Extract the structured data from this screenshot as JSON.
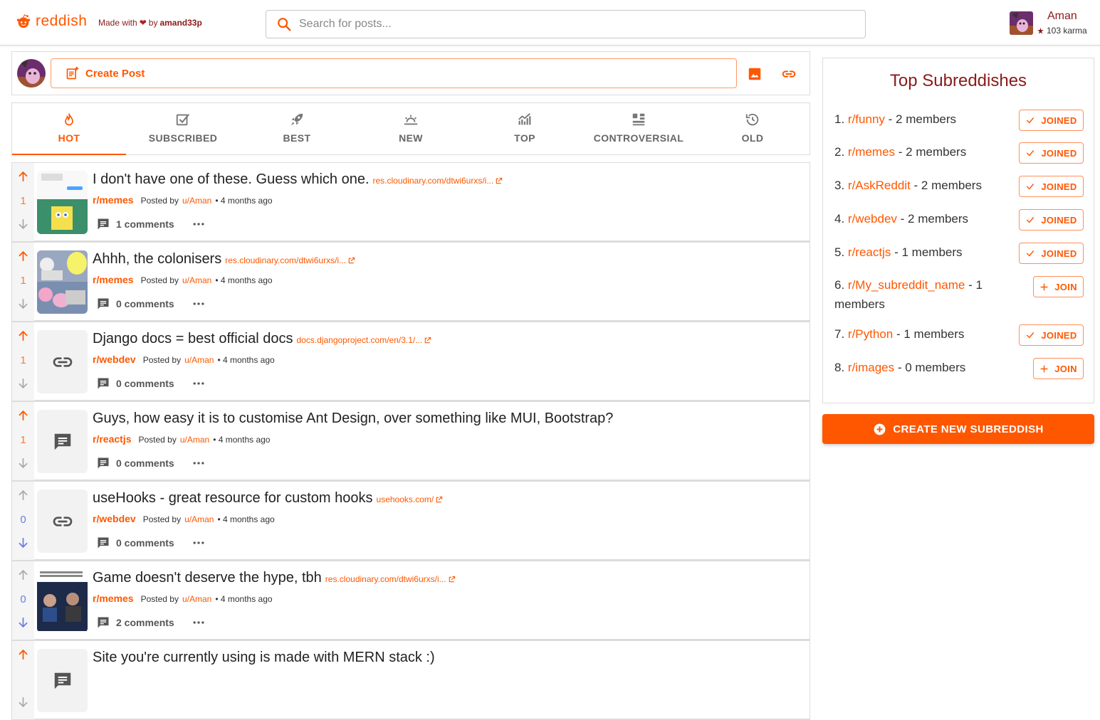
{
  "header": {
    "brand": "reddish",
    "made_with": "Made with",
    "by": "by",
    "author": "amand33p",
    "search_placeholder": "Search for posts...",
    "user": {
      "name": "Aman",
      "karma": "103 karma"
    }
  },
  "create_post": {
    "label": "Create Post"
  },
  "tabs": [
    {
      "label": "HOT",
      "icon": "fire-icon",
      "active": true
    },
    {
      "label": "SUBSCRIBED",
      "icon": "checkbox-icon"
    },
    {
      "label": "BEST",
      "icon": "rocket-icon"
    },
    {
      "label": "NEW",
      "icon": "sunrise-icon"
    },
    {
      "label": "TOP",
      "icon": "chart-up-icon"
    },
    {
      "label": "CONTROVERSIAL",
      "icon": "compare-icon"
    },
    {
      "label": "OLD",
      "icon": "history-icon"
    }
  ],
  "posts": [
    {
      "score": "1",
      "title": "I don't have one of these. Guess which one.",
      "domain": "res.cloudinary.com/dtwi6urxs/i...",
      "subreddit": "r/memes",
      "posted_by": "Posted by",
      "user": "u/Aman",
      "time": "• 4 months ago",
      "comments": "1 comments",
      "thumb": "image"
    },
    {
      "score": "1",
      "title": "Ahhh, the colonisers",
      "domain": "res.cloudinary.com/dtwi6urxs/i...",
      "subreddit": "r/memes",
      "posted_by": "Posted by",
      "user": "u/Aman",
      "time": "• 4 months ago",
      "comments": "0 comments",
      "thumb": "image"
    },
    {
      "score": "1",
      "title": "Django docs = best official docs",
      "domain": "docs.djangoproject.com/en/3.1/...",
      "subreddit": "r/webdev",
      "posted_by": "Posted by",
      "user": "u/Aman",
      "time": "• 4 months ago",
      "comments": "0 comments",
      "thumb": "link"
    },
    {
      "score": "1",
      "title": "Guys, how easy it is to customise Ant Design, over something like MUI, Bootstrap?",
      "domain": "",
      "subreddit": "r/reactjs",
      "posted_by": "Posted by",
      "user": "u/Aman",
      "time": "• 4 months ago",
      "comments": "0 comments",
      "thumb": "text"
    },
    {
      "score": "0",
      "title": "useHooks - great resource for custom hooks",
      "domain": "usehooks.com/",
      "subreddit": "r/webdev",
      "posted_by": "Posted by",
      "user": "u/Aman",
      "time": "• 4 months ago",
      "comments": "0 comments",
      "thumb": "link"
    },
    {
      "score": "0",
      "title": "Game doesn't deserve the hype, tbh",
      "domain": "res.cloudinary.com/dtwi6urxs/i...",
      "subreddit": "r/memes",
      "posted_by": "Posted by",
      "user": "u/Aman",
      "time": "• 4 months ago",
      "comments": "2 comments",
      "thumb": "image"
    },
    {
      "score": "",
      "title": "Site you're currently using is made with MERN stack :)",
      "domain": "",
      "subreddit": "",
      "posted_by": "",
      "user": "",
      "time": "",
      "comments": "",
      "thumb": "text"
    }
  ],
  "sidebar": {
    "title": "Top Subreddishes",
    "subs": [
      {
        "rank": "1.",
        "name": "r/funny",
        "members": "- 2 members",
        "action": "JOINED"
      },
      {
        "rank": "2.",
        "name": "r/memes",
        "members": "- 2 members",
        "action": "JOINED"
      },
      {
        "rank": "3.",
        "name": "r/AskReddit",
        "members": "- 2 members",
        "action": "JOINED"
      },
      {
        "rank": "4.",
        "name": "r/webdev",
        "members": "- 2 members",
        "action": "JOINED"
      },
      {
        "rank": "5.",
        "name": "r/reactjs",
        "members": "- 1 members",
        "action": "JOINED"
      },
      {
        "rank": "6.",
        "name": "r/My_subreddit_name",
        "members": "- 1 members",
        "action": "JOIN"
      },
      {
        "rank": "7.",
        "name": "r/Python",
        "members": "- 1 members",
        "action": "JOINED"
      },
      {
        "rank": "8.",
        "name": "r/images",
        "members": "- 0 members",
        "action": "JOIN"
      }
    ],
    "create_label": "CREATE NEW SUBREDDISH"
  },
  "colors": {
    "accent": "#ff5700",
    "dark_red": "#8b1a1a",
    "downvote": "#6c7de0"
  }
}
